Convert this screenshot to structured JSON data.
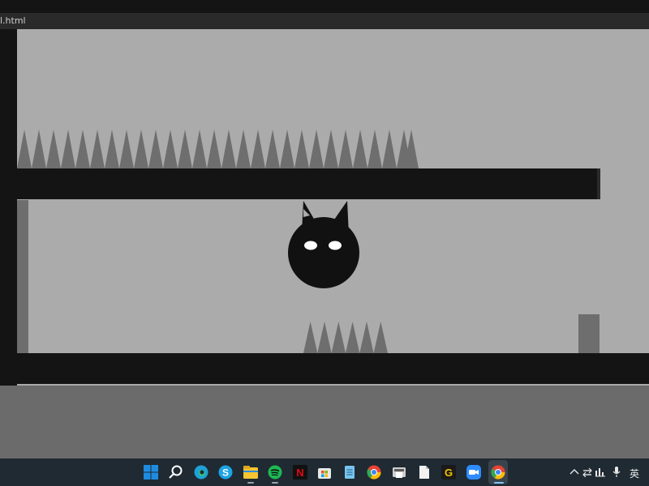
{
  "browser": {
    "tab_title": "l.html"
  },
  "game": {
    "colors": {
      "background": "#ababab",
      "platform": "#141414",
      "spike": "#6e6e6e",
      "character": "#111111",
      "eyes": "#ffffff"
    }
  },
  "taskbar": {
    "icons": [
      {
        "name": "windows-start-icon",
        "color": "#1d8ce0"
      },
      {
        "name": "search-icon",
        "color": "#ffffff"
      },
      {
        "name": "edge-icon",
        "color": "#1fa1d8"
      },
      {
        "name": "skype-icon",
        "color": "#1da3e6"
      },
      {
        "name": "file-explorer-icon",
        "color": "#f4c431"
      },
      {
        "name": "spotify-icon",
        "color": "#1db954"
      },
      {
        "name": "netflix-icon",
        "color": "#e50914"
      },
      {
        "name": "microsoft-store-icon",
        "color": "#e8e8e8"
      },
      {
        "name": "notepad-icon",
        "color": "#79c3f0"
      },
      {
        "name": "chrome-icon",
        "color": "#e84335"
      },
      {
        "name": "scanner-icon",
        "color": "#cfcfcf"
      },
      {
        "name": "document-icon",
        "color": "#f2f2f2"
      },
      {
        "name": "g-app-icon",
        "color": "#f5c400"
      },
      {
        "name": "zoom-icon",
        "color": "#2d8cff"
      },
      {
        "name": "chrome-active-icon",
        "color": "#e84335"
      }
    ],
    "tray": {
      "language": "英"
    }
  }
}
